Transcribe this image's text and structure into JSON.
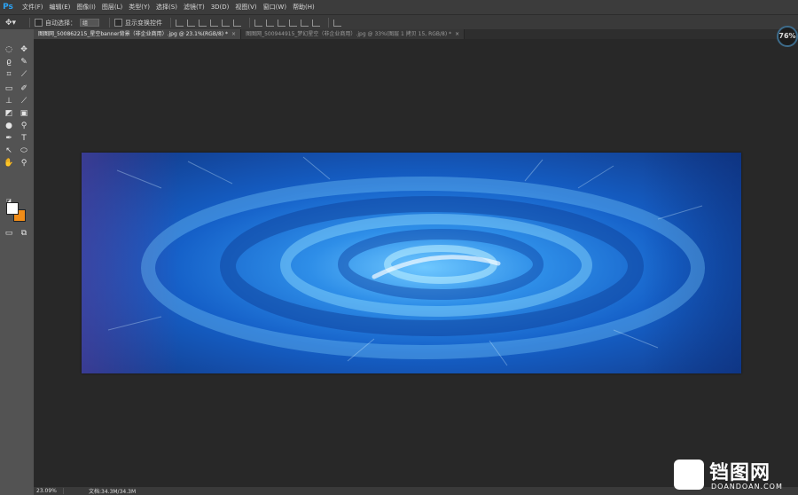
{
  "app": {
    "logo": "Ps"
  },
  "menubar": {
    "items": [
      "文件(F)",
      "编辑(E)",
      "图像(I)",
      "图层(L)",
      "类型(Y)",
      "选择(S)",
      "滤镜(T)",
      "3D(D)",
      "视图(V)",
      "窗口(W)",
      "帮助(H)"
    ]
  },
  "options": {
    "auto_select_label": "自动选择：",
    "auto_select_value": "组",
    "show_transform_label": "显示变换控件"
  },
  "tabs": [
    {
      "label": "图图网_500862215_星空banner背景（非企业商用）.jpg @ 23.1%(RGB/8) *",
      "active": true
    },
    {
      "label": "图图网_500944915_梦幻星空（非企业商用）.jpg @ 33%(图层 1 拷贝 15, RGB/8) *",
      "active": false
    }
  ],
  "zoom_badge": "76%",
  "status": {
    "zoom": "23.09%",
    "doc": "文档:34.3M/34.3M"
  },
  "colors": {
    "foreground": "#ffffff",
    "background": "#f08c18",
    "accent": "#2ba3f5"
  },
  "watermark": {
    "title": "铛图网",
    "subtitle": "DOANDOAN.COM"
  }
}
